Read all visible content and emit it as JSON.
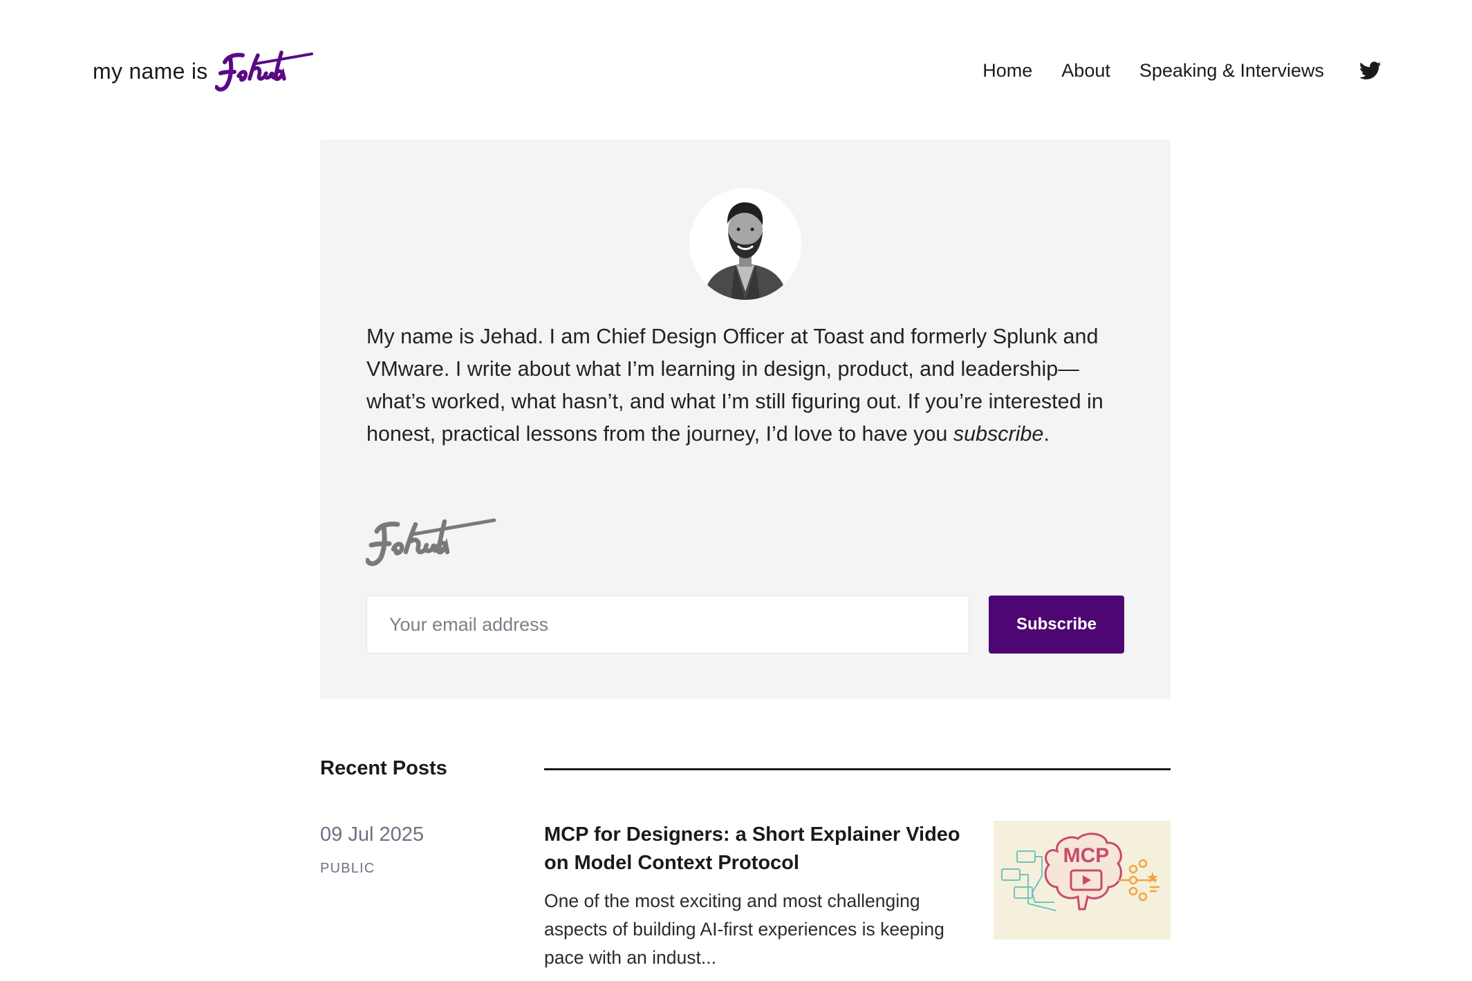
{
  "header": {
    "logo_prefix": "my name is",
    "logo_script": "Jehad",
    "nav": [
      {
        "label": "Home"
      },
      {
        "label": "About"
      },
      {
        "label": "Speaking & Interviews"
      }
    ],
    "social_icon": "twitter-icon"
  },
  "hero": {
    "bio_text": "My name is Jehad. I am Chief Design Officer at Toast and formerly Splunk and VMware. I write about what I’m learning in design, product, and leadership—what’s worked, what hasn’t, and what I’m still figuring out. If you’re interested in honest, practical lessons from the journey, I’d love to have you ",
    "bio_emphasis": "subscribe",
    "bio_end": ".",
    "signature": "Jehad",
    "email_placeholder": "Your email address",
    "subscribe_label": "Subscribe"
  },
  "recent_posts": {
    "title": "Recent Posts",
    "items": [
      {
        "date": "09 Jul 2025",
        "visibility": "PUBLIC",
        "title": "MCP for Designers: a Short Explainer Video on Model Context Protocol",
        "excerpt": "One of the most exciting and most challenging aspects of building AI-first experiences is keeping pace with an indust...",
        "thumb_label": "MCP"
      }
    ]
  },
  "colors": {
    "accent": "#4e0672",
    "card_bg": "#f4f4f4",
    "muted_text": "#6b7280"
  }
}
